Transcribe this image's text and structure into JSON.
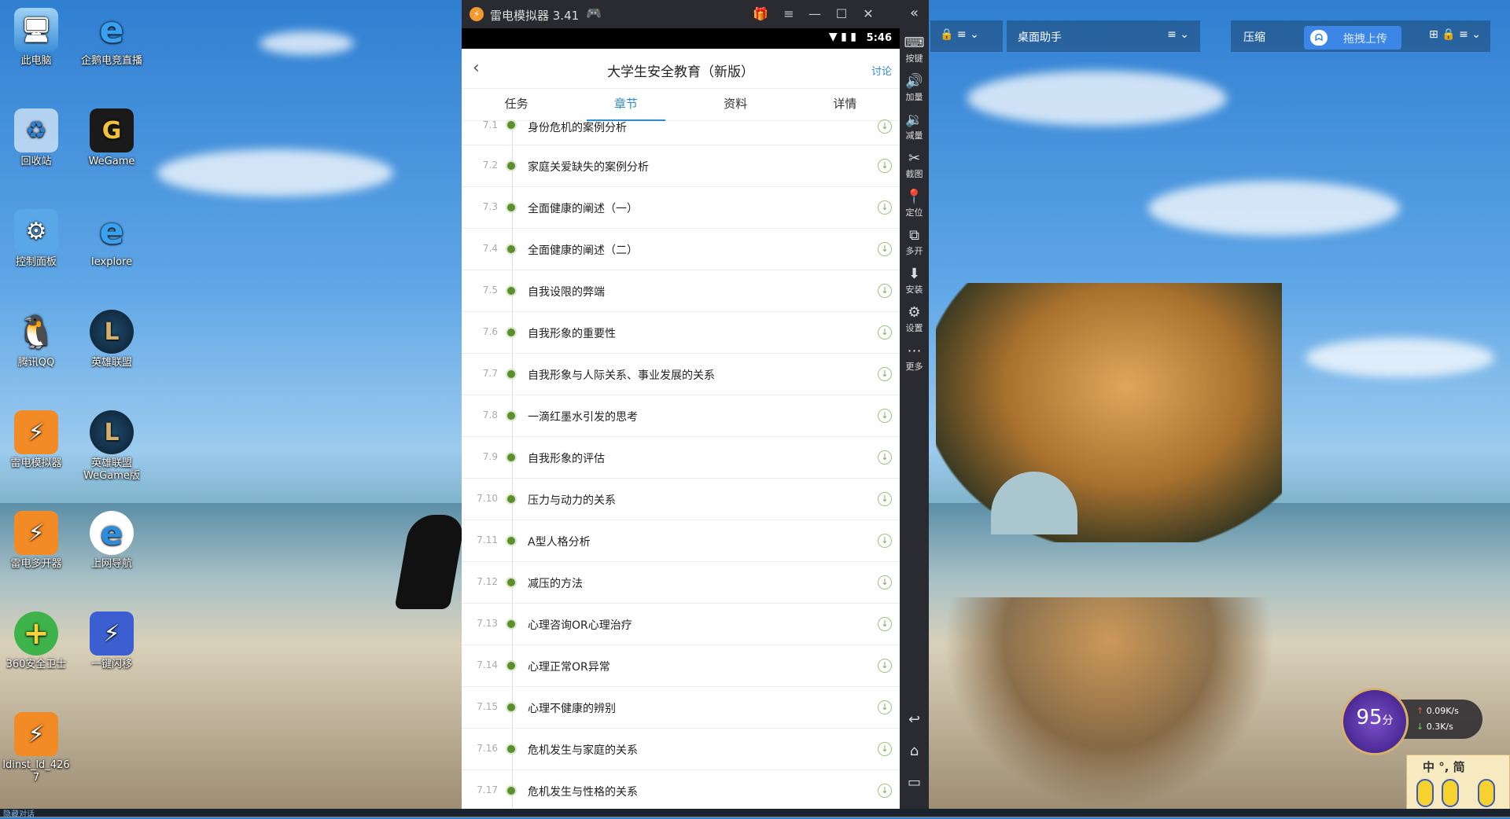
{
  "desktop": {
    "icons": [
      {
        "label": "此电脑",
        "glyph": "🖥"
      },
      {
        "label": "企鹅电竞直播",
        "glyph": "e"
      },
      {
        "label": "回收站",
        "glyph": "♻"
      },
      {
        "label": "WeGame",
        "glyph": "G"
      },
      {
        "label": "控制面板",
        "glyph": "⚙"
      },
      {
        "label": "Iexplore",
        "glyph": "e"
      },
      {
        "label": "腾讯QQ",
        "glyph": "🐧"
      },
      {
        "label": "英雄联盟",
        "glyph": "L"
      },
      {
        "label": "雷电模拟器",
        "glyph": "⚡"
      },
      {
        "label": "英雄联盟WeGame版",
        "glyph": "L"
      },
      {
        "label": "雷电多开器",
        "glyph": "⚡"
      },
      {
        "label": "上网导航",
        "glyph": "e"
      },
      {
        "label": "360安全卫士",
        "glyph": "+"
      },
      {
        "label": "一键闪移",
        "glyph": "⚡"
      },
      {
        "label": "ldinst_ld_4267",
        "glyph": "⚡"
      }
    ]
  },
  "emulator": {
    "title": "雷电模拟器 3.41",
    "window_buttons": [
      "🎁",
      "≡",
      "—",
      "☐",
      "✕"
    ],
    "status_time": "5:46",
    "status_icons": "▼ ▮ ▮",
    "app": {
      "title": "大学生安全教育（新版）",
      "back": "‹",
      "discuss": "讨论",
      "tabs": [
        "任务",
        "章节",
        "资料",
        "详情"
      ],
      "active_tab": 1,
      "chapters": [
        {
          "num": "7.1",
          "title": "身份危机的案例分析"
        },
        {
          "num": "7.2",
          "title": "家庭关爱缺失的案例分析"
        },
        {
          "num": "7.3",
          "title": "全面健康的阐述（一）"
        },
        {
          "num": "7.4",
          "title": "全面健康的阐述（二）"
        },
        {
          "num": "7.5",
          "title": "自我设限的弊端"
        },
        {
          "num": "7.6",
          "title": "自我形象的重要性"
        },
        {
          "num": "7.7",
          "title": "自我形象与人际关系、事业发展的关系"
        },
        {
          "num": "7.8",
          "title": "一滴红墨水引发的思考"
        },
        {
          "num": "7.9",
          "title": "自我形象的评估"
        },
        {
          "num": "7.10",
          "title": "压力与动力的关系"
        },
        {
          "num": "7.11",
          "title": "A型人格分析"
        },
        {
          "num": "7.12",
          "title": "减压的方法"
        },
        {
          "num": "7.13",
          "title": "心理咨询OR心理治疗"
        },
        {
          "num": "7.14",
          "title": "心理正常OR异常"
        },
        {
          "num": "7.15",
          "title": "心理不健康的辨别"
        },
        {
          "num": "7.16",
          "title": "危机发生与家庭的关系"
        },
        {
          "num": "7.17",
          "title": "危机发生与性格的关系"
        }
      ]
    },
    "sidebar": [
      {
        "glyph": "⌨",
        "label": "按键"
      },
      {
        "glyph": "🔊",
        "label": "加量"
      },
      {
        "glyph": "🔉",
        "label": "减量"
      },
      {
        "glyph": "✂",
        "label": "截图"
      },
      {
        "glyph": "📍",
        "label": "定位"
      },
      {
        "glyph": "⧉",
        "label": "多开"
      },
      {
        "glyph": "⬇",
        "label": "安装"
      },
      {
        "glyph": "⚙",
        "label": "设置"
      },
      {
        "glyph": "⋯",
        "label": "更多"
      }
    ],
    "nav": [
      "↩",
      "⌂",
      "▭"
    ]
  },
  "toolbars": {
    "bar1_icons": "🔒 ≡ ⌄",
    "assistant_label": "桌面助手",
    "assistant_icons": "≡ ⌄",
    "compress_label": "压缩",
    "upload_label": "拖拽上传",
    "upload_icon": "ᗣ",
    "right_icons": "⊞ 🔒 ≡ ⌄"
  },
  "widgets": {
    "score_value": "95",
    "score_unit": "分",
    "upload_speed": "0.09K/s",
    "download_speed": "0.3K/s",
    "ime_text": "中 °, 简 ",
    "taskbar_text": "隐藏对话"
  }
}
